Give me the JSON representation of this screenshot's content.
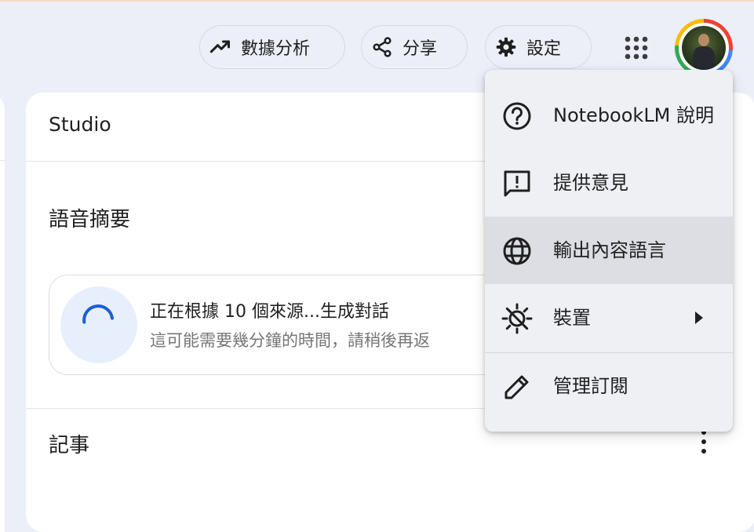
{
  "header": {
    "analytics_label": "數據分析",
    "share_label": "分享",
    "settings_label": "設定"
  },
  "studio": {
    "title": "Studio",
    "audio_overview_title": "語音摘要",
    "generating_title": "正在根據 10 個來源...生成對話",
    "generating_subtitle": "這可能需要幾分鐘的時間，請稍後再返",
    "notes_title": "記事"
  },
  "menu": {
    "items": [
      {
        "label": "NotebookLM 說明",
        "icon": "help-icon"
      },
      {
        "label": "提供意見",
        "icon": "feedback-icon"
      },
      {
        "label": "輸出內容語言",
        "icon": "globe-icon",
        "highlighted": true
      },
      {
        "label": "裝置",
        "icon": "device-theme-icon",
        "has_submenu": true
      },
      {
        "label": "管理訂閱",
        "icon": "pencil-icon"
      }
    ]
  },
  "colors": {
    "background": "#eceef8",
    "panel": "#ffffff",
    "menu_background": "#eef0f4",
    "menu_highlight": "#dcdee3",
    "spinner_bg": "#e8effc",
    "spinner_arc": "#1a5fd6"
  }
}
